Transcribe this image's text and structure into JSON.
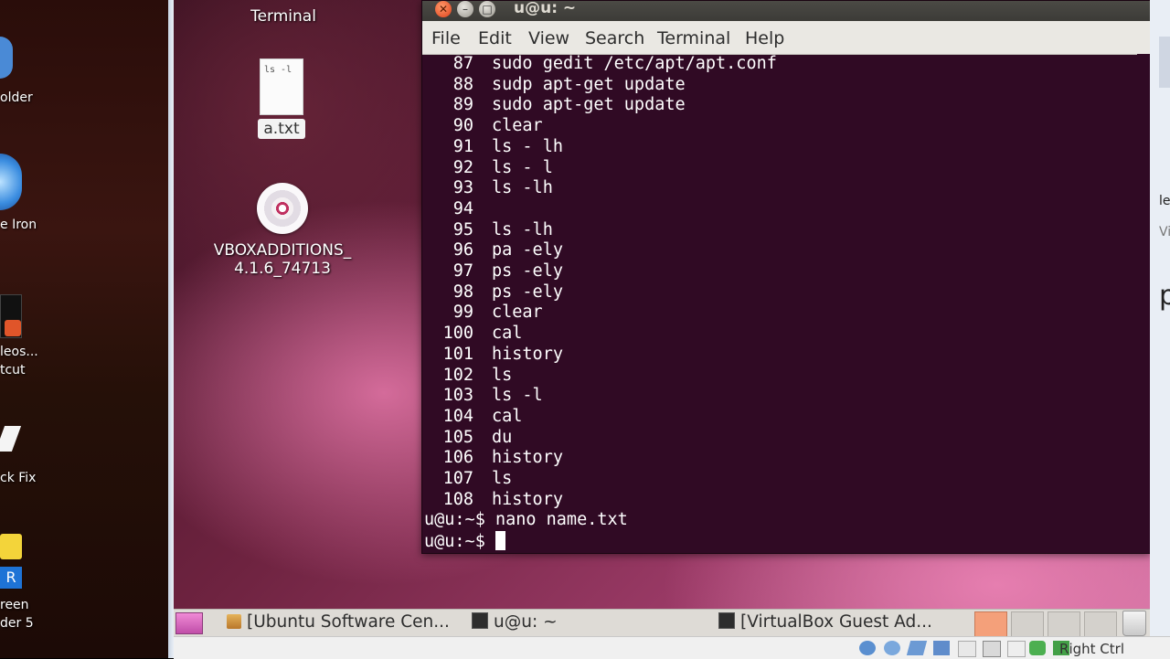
{
  "host_desktop": {
    "icons": [
      {
        "label": "older"
      },
      {
        "label": "e Iron"
      },
      {
        "label": "leos..."
      },
      {
        "label": "tcut"
      },
      {
        "label": "ck Fix"
      },
      {
        "label": "reen"
      },
      {
        "label": "der 5"
      }
    ]
  },
  "guest_desktop": {
    "terminal_icon_label": "Terminal",
    "file_icon_text": "ls -l",
    "file_label": "a.txt",
    "cd_label_line1": "VBOXADDITIONS_",
    "cd_label_line2": "4.1.6_74713"
  },
  "terminal": {
    "title": "u@u: ~",
    "menu": [
      "File",
      "Edit",
      "View",
      "Search",
      "Terminal",
      "Help"
    ],
    "history": [
      {
        "num": "87",
        "cmd": "sudo gedit /etc/apt/apt.conf"
      },
      {
        "num": "88",
        "cmd": "sudp apt-get update"
      },
      {
        "num": "89",
        "cmd": "sudo apt-get update"
      },
      {
        "num": "90",
        "cmd": "clear"
      },
      {
        "num": "91",
        "cmd": "ls - lh"
      },
      {
        "num": "92",
        "cmd": "ls - l"
      },
      {
        "num": "93",
        "cmd": "ls -lh"
      },
      {
        "num": "94",
        "cmd": ""
      },
      {
        "num": "95",
        "cmd": "ls -lh"
      },
      {
        "num": "96",
        "cmd": "pa -ely"
      },
      {
        "num": "97",
        "cmd": "ps -ely"
      },
      {
        "num": "98",
        "cmd": "ps -ely"
      },
      {
        "num": "99",
        "cmd": "clear"
      },
      {
        "num": "100",
        "cmd": "cal"
      },
      {
        "num": "101",
        "cmd": "history"
      },
      {
        "num": "102",
        "cmd": "ls"
      },
      {
        "num": "103",
        "cmd": "ls -l"
      },
      {
        "num": "104",
        "cmd": "cal"
      },
      {
        "num": "105",
        "cmd": "du"
      },
      {
        "num": "106",
        "cmd": "history"
      },
      {
        "num": "107",
        "cmd": "ls"
      },
      {
        "num": "108",
        "cmd": "history"
      }
    ],
    "prompt": "u@u:~$",
    "last_command": "nano name.txt"
  },
  "taskbar": {
    "tasks": [
      "[Ubuntu Software Cen...",
      "u@u: ~",
      "[VirtualBox Guest Ad..."
    ]
  },
  "host_status": {
    "host_key_label": "Right Ctrl"
  },
  "host_right_fragments": [
    "le",
    "Vi",
    "p"
  ]
}
